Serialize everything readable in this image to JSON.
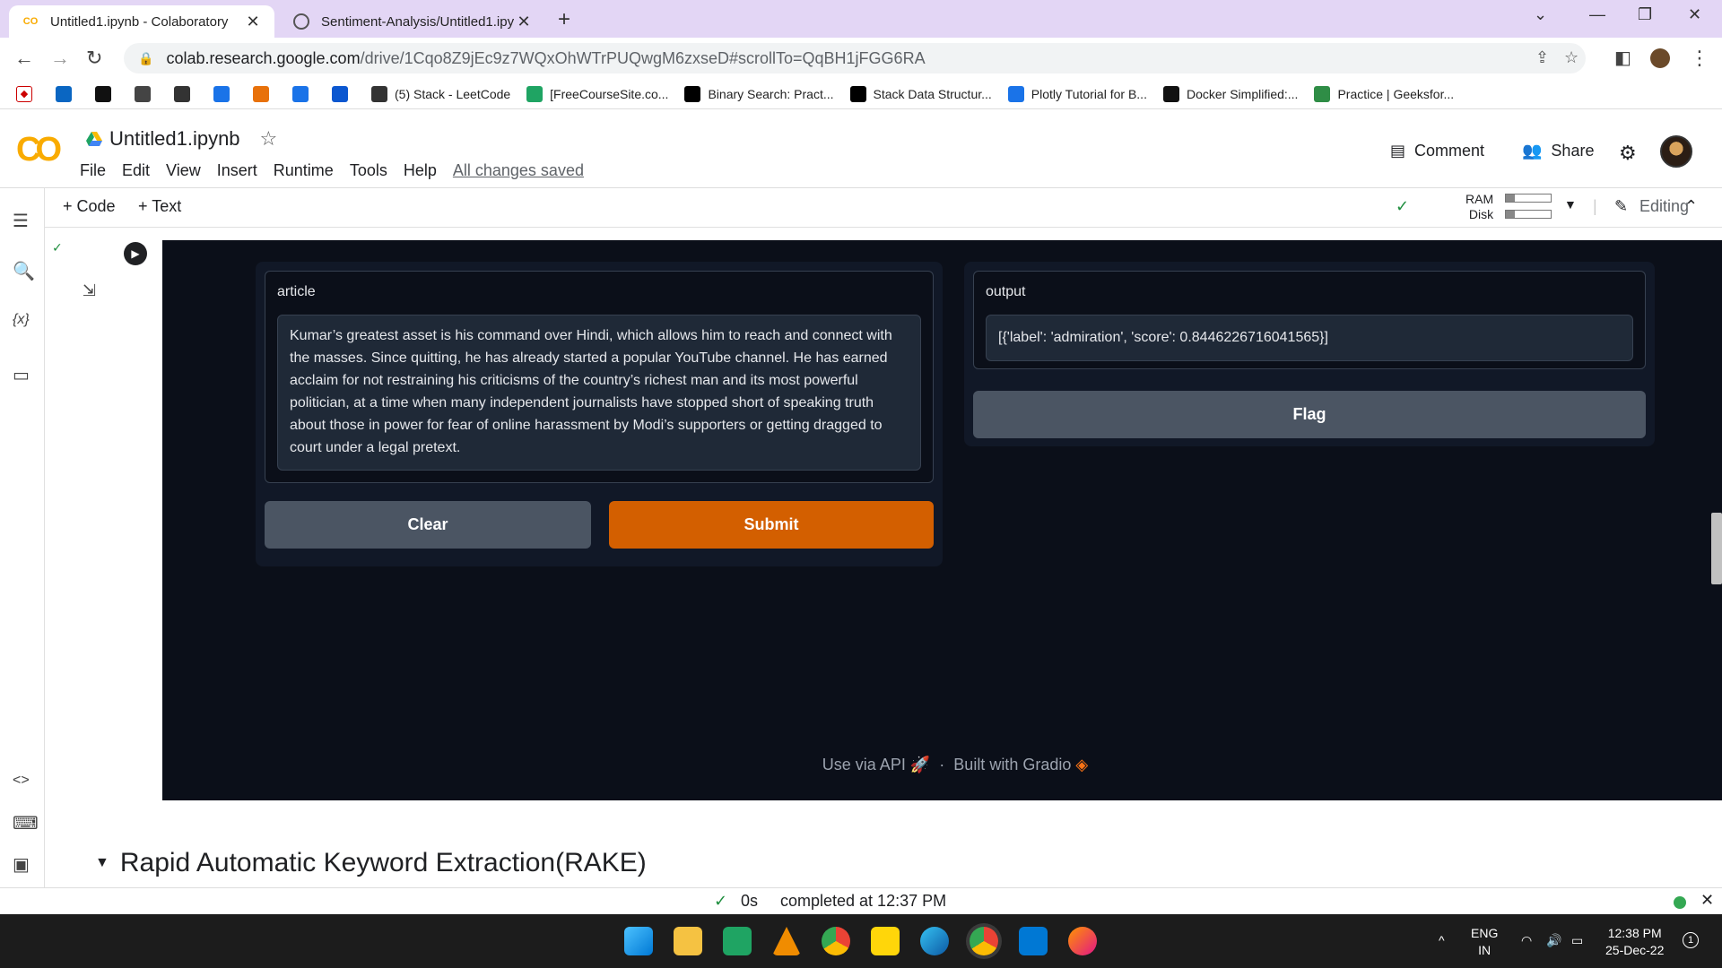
{
  "browser": {
    "tabs": [
      {
        "title": "Untitled1.ipynb - Colaboratory",
        "active": true,
        "favicon": "colab-icon"
      },
      {
        "title": "Sentiment-Analysis/Untitled1.ipy",
        "active": false,
        "favicon": "github-icon"
      }
    ],
    "url_host": "colab.research.google.com",
    "url_path": "/drive/1Cqo8Z9jEc9z7WQxOhWTrPUQwgM6zxseD#scrollTo=QqBH1jFGG6RA",
    "bookmarks": [
      {
        "label": "",
        "icon": "linkedin-icon",
        "color": "#0a66c2"
      },
      {
        "label": "",
        "icon": "hackerrank-icon",
        "color": "#111"
      },
      {
        "label": "",
        "icon": "cc-icon",
        "color": "#444"
      },
      {
        "label": "",
        "icon": "leetcode-icon",
        "color": "#333"
      },
      {
        "label": "",
        "icon": "k-icon",
        "color": "#1a73e8"
      },
      {
        "label": "",
        "icon": "gfg-icon",
        "color": "#e8710a"
      },
      {
        "label": "",
        "icon": "c-icon",
        "color": "#1a73e8"
      },
      {
        "label": "",
        "icon": "video-icon",
        "color": "#0b57d0"
      },
      {
        "label": "(5) Stack - LeetCode",
        "icon": "leetcode-icon",
        "color": "#333"
      },
      {
        "label": "[FreeCourseSite.co...",
        "icon": "drive-icon",
        "color": "#1fa463"
      },
      {
        "label": "Binary Search: Pract...",
        "icon": "medium-icon",
        "color": "#000"
      },
      {
        "label": "Stack Data Structur...",
        "icon": "medium-icon",
        "color": "#000"
      },
      {
        "label": "Plotly Tutorial for B...",
        "icon": "k-icon",
        "color": "#1a73e8"
      },
      {
        "label": "Docker Simplified:...",
        "icon": "docker-icon",
        "color": "#111"
      },
      {
        "label": "Practice | Geeksfor...",
        "icon": "gfg-icon",
        "color": "#2f8d46"
      }
    ]
  },
  "colab": {
    "notebook_title": "Untitled1.ipynb",
    "menu": [
      "File",
      "Edit",
      "View",
      "Insert",
      "Runtime",
      "Tools",
      "Help"
    ],
    "saved_status": "All changes saved",
    "comment_label": "Comment",
    "share_label": "Share",
    "add_code": "+ Code",
    "add_text": "+ Text",
    "ram_label": "RAM",
    "disk_label": "Disk",
    "editing_label": "Editing",
    "section_heading": "Rapid Automatic Keyword Extraction(RAKE)",
    "status_time": "0s",
    "status_text": "completed at 12:37 PM"
  },
  "gradio": {
    "input_label": "article",
    "input_text": "Kumar’s greatest asset is his command over Hindi, which allows him to reach and connect with the masses. Since quitting, he has already started a popular YouTube channel. He has earned acclaim for not restraining his criticisms of the country’s richest man and its most powerful politician, at a time when many independent journalists have stopped short of speaking truth about those in power for fear of online harassment by Modi’s supporters or getting dragged to court under a legal pretext.",
    "output_label": "output",
    "output_text": "[{'label': 'admiration', 'score': 0.8446226716041565}]",
    "clear_label": "Clear",
    "submit_label": "Submit",
    "flag_label": "Flag",
    "footer_api": "Use via API",
    "footer_sep": "·",
    "footer_built": "Built with Gradio",
    "colors": {
      "bg": "#0b0f19",
      "submit": "#d35f00",
      "secondary": "#4b5563"
    }
  },
  "taskbar": {
    "lang_top": "ENG",
    "lang_bottom": "IN",
    "time": "12:38 PM",
    "date": "25-Dec-22",
    "notif_count": "1"
  }
}
